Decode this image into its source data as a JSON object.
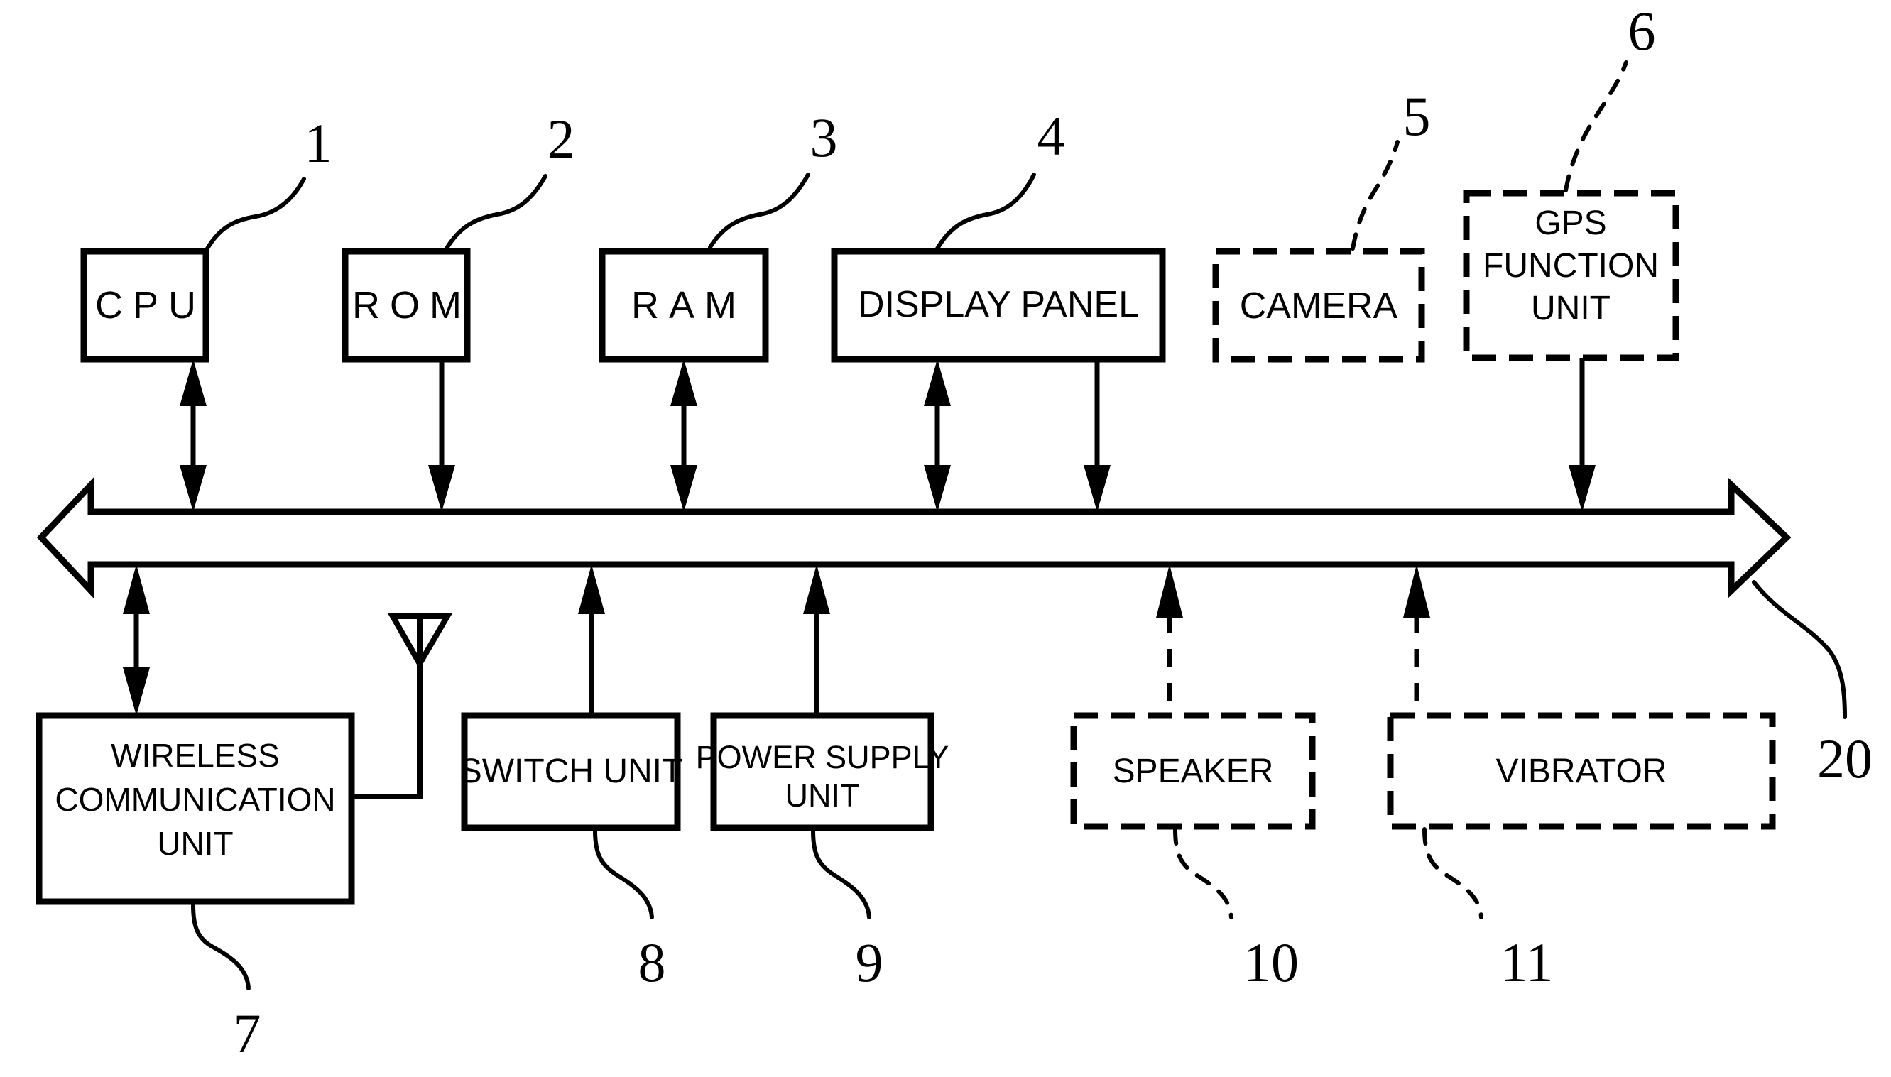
{
  "figure": {
    "kind": "patent-block-diagram",
    "background_color": "#ffffff",
    "line_color": "#000000"
  },
  "blocks": [
    {
      "id": "cpu",
      "label": "CPU",
      "ref": "1",
      "style": "solid",
      "tracking": "wide"
    },
    {
      "id": "rom",
      "label": "ROM",
      "ref": "2",
      "style": "solid",
      "tracking": "wide"
    },
    {
      "id": "ram",
      "label": "RAM",
      "ref": "3",
      "style": "solid",
      "tracking": "wide"
    },
    {
      "id": "display",
      "label": "DISPLAY PANEL",
      "ref": "4",
      "style": "solid",
      "tracking": "normal"
    },
    {
      "id": "camera",
      "label": "CAMERA",
      "ref": "5",
      "style": "dashed",
      "tracking": "normal"
    },
    {
      "id": "gps",
      "label": "GPS FUNCTION UNIT",
      "ref": "6",
      "style": "dashed",
      "tracking": "normal",
      "label_lines": [
        "GPS",
        "FUNCTION",
        "UNIT"
      ]
    },
    {
      "id": "wireless",
      "label": "WIRELESS COMMUNICATION UNIT",
      "ref": "7",
      "style": "solid",
      "tracking": "normal",
      "label_lines": [
        "WIRELESS",
        "COMMUNICATION",
        "UNIT"
      ]
    },
    {
      "id": "switch",
      "label": "SWITCH UNIT",
      "ref": "8",
      "style": "solid",
      "tracking": "normal"
    },
    {
      "id": "power",
      "label": "POWER SUPPLY UNIT",
      "ref": "9",
      "style": "solid",
      "tracking": "normal",
      "label_lines": [
        "POWER SUPPLY",
        "UNIT"
      ]
    },
    {
      "id": "speaker",
      "label": "SPEAKER",
      "ref": "10",
      "style": "dashed",
      "tracking": "normal"
    },
    {
      "id": "vibrator",
      "label": "VIBRATOR",
      "ref": "11",
      "style": "dashed",
      "tracking": "normal"
    }
  ],
  "bus": {
    "id": "system-bus",
    "ref": "20",
    "shape": "double-headed-hollow-arrow"
  },
  "antenna": {
    "id": "antenna",
    "symbol": "triangle-dipole"
  },
  "connections": [
    {
      "from": "cpu",
      "to": "bus",
      "direction": "bidirectional",
      "line": "solid"
    },
    {
      "from": "rom",
      "to": "bus",
      "direction": "down",
      "line": "solid"
    },
    {
      "from": "ram",
      "to": "bus",
      "direction": "bidirectional",
      "line": "solid"
    },
    {
      "from": "display",
      "to": "bus",
      "direction": "bidirectional",
      "line": "solid"
    },
    {
      "from": "camera",
      "to": "bus",
      "direction": "down",
      "line": "solid"
    },
    {
      "from": "gps",
      "to": "bus",
      "direction": "down",
      "line": "solid"
    },
    {
      "from": "wireless",
      "to": "bus",
      "direction": "bidirectional",
      "line": "solid"
    },
    {
      "from": "switch",
      "to": "bus",
      "direction": "up",
      "line": "solid"
    },
    {
      "from": "power",
      "to": "bus",
      "direction": "up",
      "line": "solid"
    },
    {
      "from": "speaker",
      "to": "bus",
      "direction": "up",
      "line": "dashed"
    },
    {
      "from": "vibrator",
      "to": "bus",
      "direction": "up",
      "line": "dashed"
    }
  ],
  "ref_numbers": {
    "cpu": "1",
    "rom": "2",
    "ram": "3",
    "display": "4",
    "camera": "5",
    "gps": "6",
    "wireless": "7",
    "switch": "8",
    "power": "9",
    "speaker": "10",
    "vibrator": "11",
    "bus": "20"
  },
  "labels": {
    "cpu": "CPU",
    "rom": "ROM",
    "ram": "RAM",
    "display": "DISPLAY PANEL",
    "camera": "CAMERA",
    "gps_l1": "GPS",
    "gps_l2": "FUNCTION",
    "gps_l3": "UNIT",
    "wireless_l1": "WIRELESS",
    "wireless_l2": "COMMUNICATION",
    "wireless_l3": "UNIT",
    "switch": "SWITCH UNIT",
    "power_l1": "POWER SUPPLY",
    "power_l2": "UNIT",
    "speaker": "SPEAKER",
    "vibrator": "VIBRATOR"
  }
}
